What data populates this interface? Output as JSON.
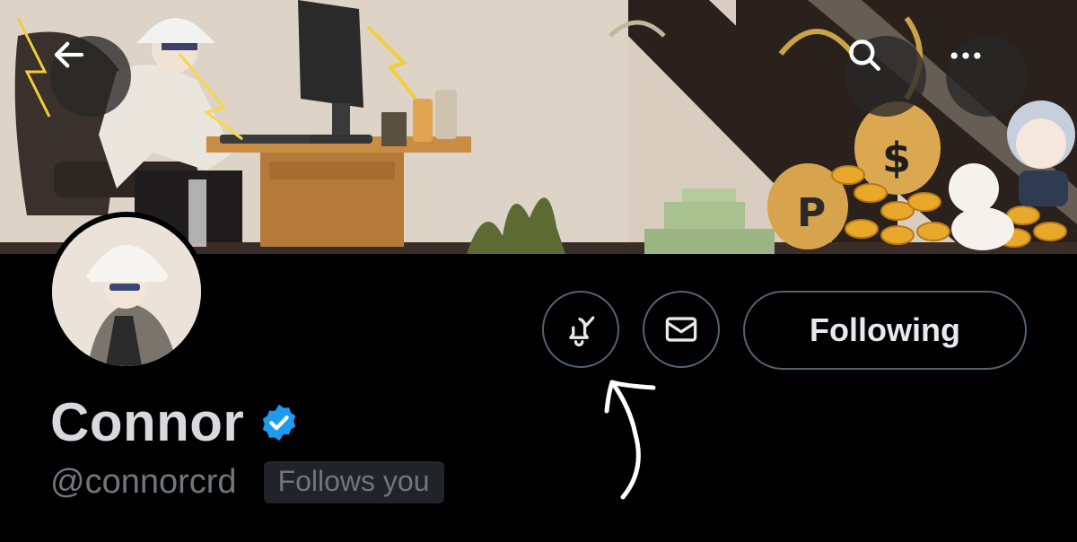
{
  "profile": {
    "display_name": "Connor",
    "handle": "@connorcrd",
    "follows_you_badge": "Follows you",
    "verified": true
  },
  "actions": {
    "following_label": "Following"
  },
  "icons": {
    "back": "arrow-left-icon",
    "search": "search-icon",
    "more": "more-horizontal-icon",
    "notify": "bell-check-icon",
    "message": "envelope-icon",
    "verified": "verified-badge-icon"
  },
  "colors": {
    "background": "#000000",
    "verified_blue": "#1d9bf0",
    "button_border": "#536471",
    "secondary_text": "#71767b",
    "banner_gold": "#e8a82a"
  }
}
